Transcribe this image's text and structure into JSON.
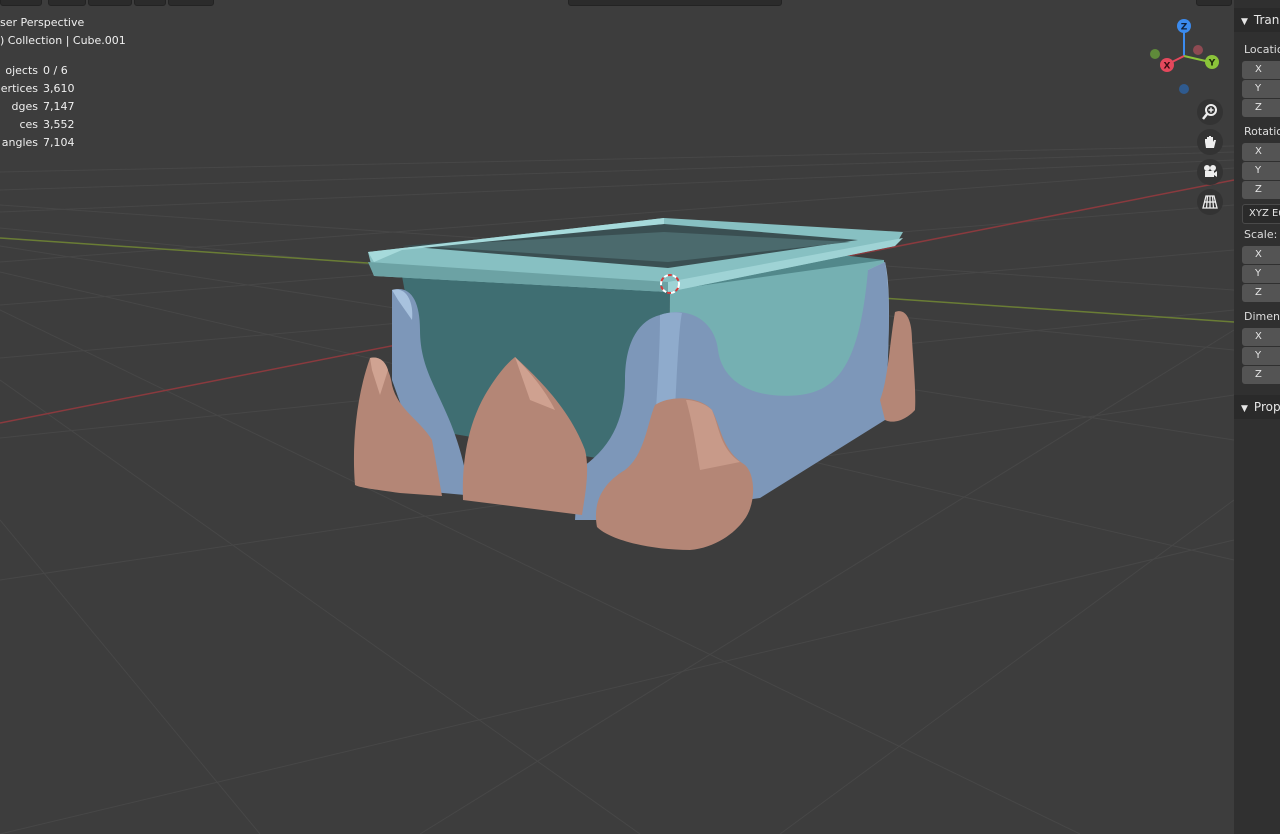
{
  "viewport": {
    "mode_label": "ser Perspective",
    "collection_label": ") Collection | Cube.001",
    "stats": [
      {
        "label": "ojects",
        "value": "0 / 6"
      },
      {
        "label": "ertices",
        "value": "3,610"
      },
      {
        "label": "dges",
        "value": "7,147"
      },
      {
        "label": "ces",
        "value": "3,552"
      },
      {
        "label": "angles",
        "value": "7,104"
      }
    ],
    "background_color": "#3d3d3d"
  },
  "gizmo": {
    "x_label": "X",
    "y_label": "Y",
    "z_label": "Z",
    "x_color": "#e4485c",
    "y_color": "#8bc43a",
    "z_color": "#3b8bef"
  },
  "nav_icons": [
    "zoom-icon",
    "hand-pan-icon",
    "camera-icon",
    "ortho-grid-icon"
  ],
  "sidebar": {
    "transform_header": "Tran",
    "location_label": "Locatio",
    "rotation_label": "Rotatio",
    "rotation_mode": "XYZ Eu",
    "scale_label": "Scale:",
    "dimensions_label": "Dimens",
    "axis_x": "X",
    "axis_y": "Y",
    "axis_z": "Z",
    "properties_header": "Prop"
  },
  "model_colors": {
    "rim": "#8dc7c9",
    "inner_wall": "#6aa3a6",
    "side_panel": "#7f9bbd",
    "foot": "#c39383"
  }
}
